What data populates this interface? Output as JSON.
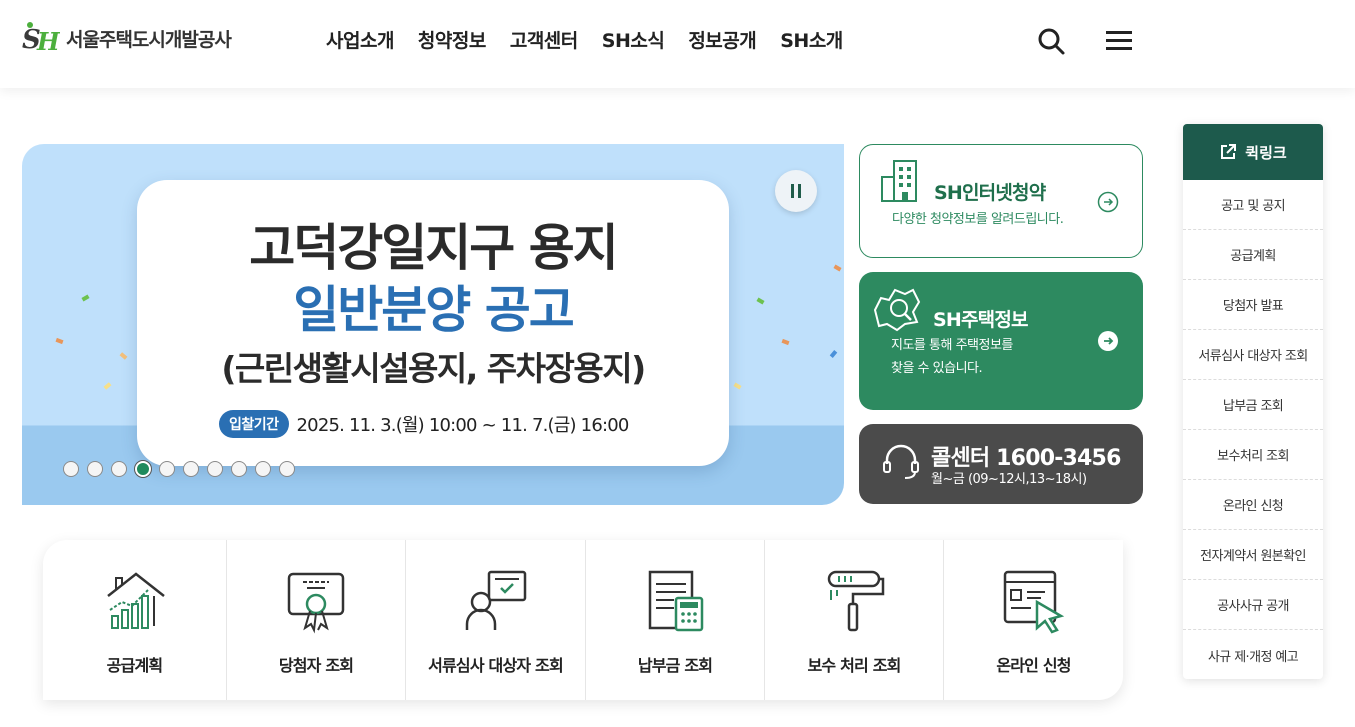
{
  "header": {
    "logo_text": "서울주택도시개발공사",
    "nav": [
      "사업소개",
      "청약정보",
      "고객센터",
      "SH소식",
      "정보공개",
      "SH소개"
    ],
    "search_icon": "search-icon",
    "menu_icon": "hamburger-menu-icon"
  },
  "hero": {
    "title_line1": "고덕강일지구 용지",
    "title_line2": "일반분양 공고",
    "title_line3": "(근린생활시설용지, 주차장용지)",
    "period_badge": "입찰기간",
    "period_text": "2025. 11. 3.(월) 10:00 ~ 11. 7.(금) 16:00",
    "slide_count": 10,
    "active_slide": 4,
    "colors": {
      "title_blue": "#2a6fb3",
      "bg": "#bfe0fb"
    }
  },
  "cards": {
    "apply": {
      "title": "SH인터넷청약",
      "subtitle": "다양한 청약정보를 알려드립니다."
    },
    "housing": {
      "title": "SH주택정보",
      "subtitle_line1": "지도를 통해 주택정보를",
      "subtitle_line2": "찾을 수 있습니다."
    },
    "call": {
      "title": "콜센터 1600-3456",
      "hours": "월~금 (09~12시,13~18시)"
    },
    "colors": {
      "green": "#2d8a60",
      "dark": "#4b4b4b"
    }
  },
  "quicklinks": {
    "title": "퀵링크",
    "items": [
      "공고 및 공지",
      "공급계획",
      "당첨자 발표",
      "서류심사 대상자 조회",
      "납부금 조회",
      "보수처리 조회",
      "온라인 신청",
      "전자계약서 원본확인",
      "공사사규 공개",
      "사규 제·개정 예고"
    ],
    "colors": {
      "head": "#1d5a4c"
    }
  },
  "services": [
    {
      "label": "공급계획",
      "icon": "house-chart-icon"
    },
    {
      "label": "당첨자 조회",
      "icon": "certificate-icon"
    },
    {
      "label": "서류심사 대상자 조회",
      "icon": "person-document-icon"
    },
    {
      "label": "납부금 조회",
      "icon": "calculator-document-icon"
    },
    {
      "label": "보수 처리 조회",
      "icon": "paint-roller-icon"
    },
    {
      "label": "온라인 신청",
      "icon": "online-form-cursor-icon"
    }
  ]
}
